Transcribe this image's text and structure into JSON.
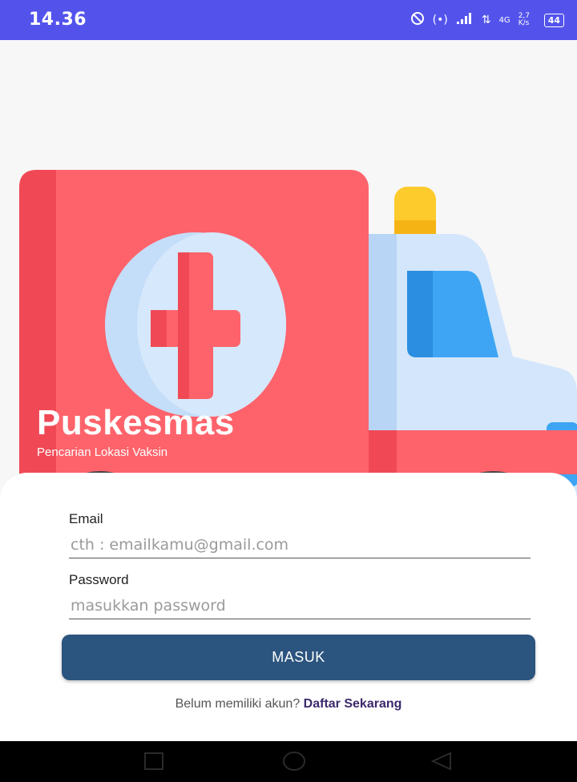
{
  "status_bar": {
    "time": "14.36",
    "icons": [
      "do-not-disturb-icon",
      "hotspot-icon",
      "signal-icon",
      "data-arrows-icon",
      "4g-signal-icon",
      "network-speed-icon",
      "battery-icon"
    ],
    "indicators": {
      "hotspot": "(•)",
      "network_type": "4G",
      "speed": "2,7 K/s",
      "battery": "44"
    }
  },
  "hero": {
    "title": "Puskesmas",
    "subtitle": "Pencarian Lokasi Vaksin"
  },
  "login": {
    "email_label": "Email",
    "email_placeholder": "cth : emailkamu@gmail.com",
    "password_label": "Password",
    "password_placeholder": "masukkan password",
    "submit_label": "MASUK",
    "register_prompt": "Belum memiliki akun? ",
    "register_link": "Daftar Sekarang"
  },
  "nav_bar": {
    "buttons": [
      "recent-apps-icon",
      "home-icon",
      "back-icon"
    ]
  },
  "colors": {
    "status_bar": "#5353ec",
    "ambulance_red": "#fe636b",
    "button": "#2b547e",
    "link": "#3b2a6b"
  }
}
